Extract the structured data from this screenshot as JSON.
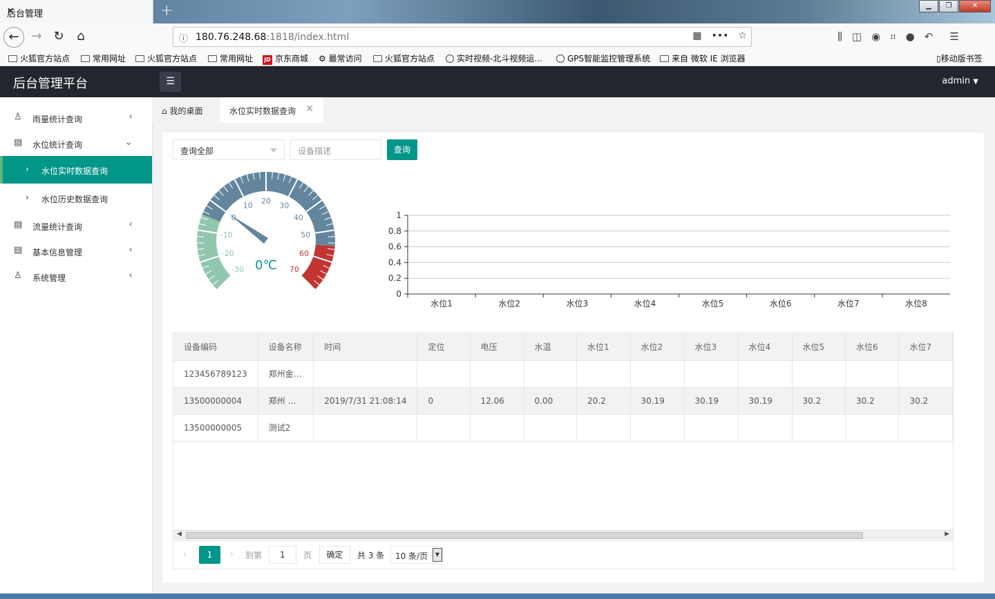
{
  "browser": {
    "tab_title": "后台管理",
    "url_host": "180.76.248.68",
    "url_rest": ":1818/index.html",
    "bookmarks": [
      "火狐官方站点",
      "常用网址",
      "火狐官方站点",
      "常用网址",
      "京东商城",
      "最常访问",
      "火狐官方站点",
      "实时视频-北斗视频运...",
      "GPS智能监控管理系统",
      "来自 微软 IE 浏览器"
    ],
    "jd_logo": "JD",
    "mobile_bookmarks": "移动版书签"
  },
  "app": {
    "title": "后台管理平台",
    "user": "admin"
  },
  "sidebar": {
    "items": [
      {
        "label": "雨量统计查询"
      },
      {
        "label": "水位统计查询"
      },
      {
        "label": "水位实时数据查询"
      },
      {
        "label": "水位历史数据查询"
      },
      {
        "label": "流量统计查询"
      },
      {
        "label": "基本信息管理"
      },
      {
        "label": "系统管理"
      }
    ]
  },
  "page_tabs": {
    "home": "我的桌面",
    "current": "水位实时数据查询"
  },
  "filters": {
    "select_value": "查询全部",
    "device_placeholder": "设备描述",
    "query_button": "查询"
  },
  "gauge": {
    "value_label": "0℃",
    "value": 0,
    "min": -30,
    "max": 70,
    "ticks": [
      "-30",
      "-20",
      "-10",
      "0",
      "10",
      "20",
      "30",
      "40",
      "50",
      "60",
      "70"
    ]
  },
  "chart_data": {
    "type": "bar",
    "categories": [
      "水位1",
      "水位2",
      "水位3",
      "水位4",
      "水位5",
      "水位6",
      "水位7",
      "水位8"
    ],
    "values": [
      0,
      0,
      0,
      0,
      0,
      0,
      0,
      0
    ],
    "ylim": [
      0,
      1
    ],
    "yticks": [
      "0",
      "0.2",
      "0.4",
      "0.6",
      "0.8",
      "1"
    ],
    "grid": true
  },
  "table": {
    "headers": [
      "设备编码",
      "设备名称",
      "时间",
      "定位",
      "电压",
      "水温",
      "水位1",
      "水位2",
      "水位3",
      "水位4",
      "水位5",
      "水位6",
      "水位7"
    ],
    "rows": [
      [
        "123456789123",
        "郑州金…",
        "",
        "",
        "",
        "",
        "",
        "",
        "",
        "",
        "",
        "",
        ""
      ],
      [
        "13500000004",
        "郑州 …",
        "2019/7/31 21:08:14",
        "0",
        "12.06",
        "0.00",
        "20.2",
        "30.19",
        "30.19",
        "30.19",
        "30.2",
        "30.2",
        "30.2"
      ],
      [
        "13500000005",
        "测试2",
        "",
        "",
        "",
        "",
        "",
        "",
        "",
        "",
        "",
        "",
        ""
      ]
    ]
  },
  "pager": {
    "current_page": "1",
    "goto_label": "到第",
    "page_input": "1",
    "page_suffix": "页",
    "confirm": "确定",
    "total": "共 3 条",
    "page_size": "10 条/页"
  }
}
